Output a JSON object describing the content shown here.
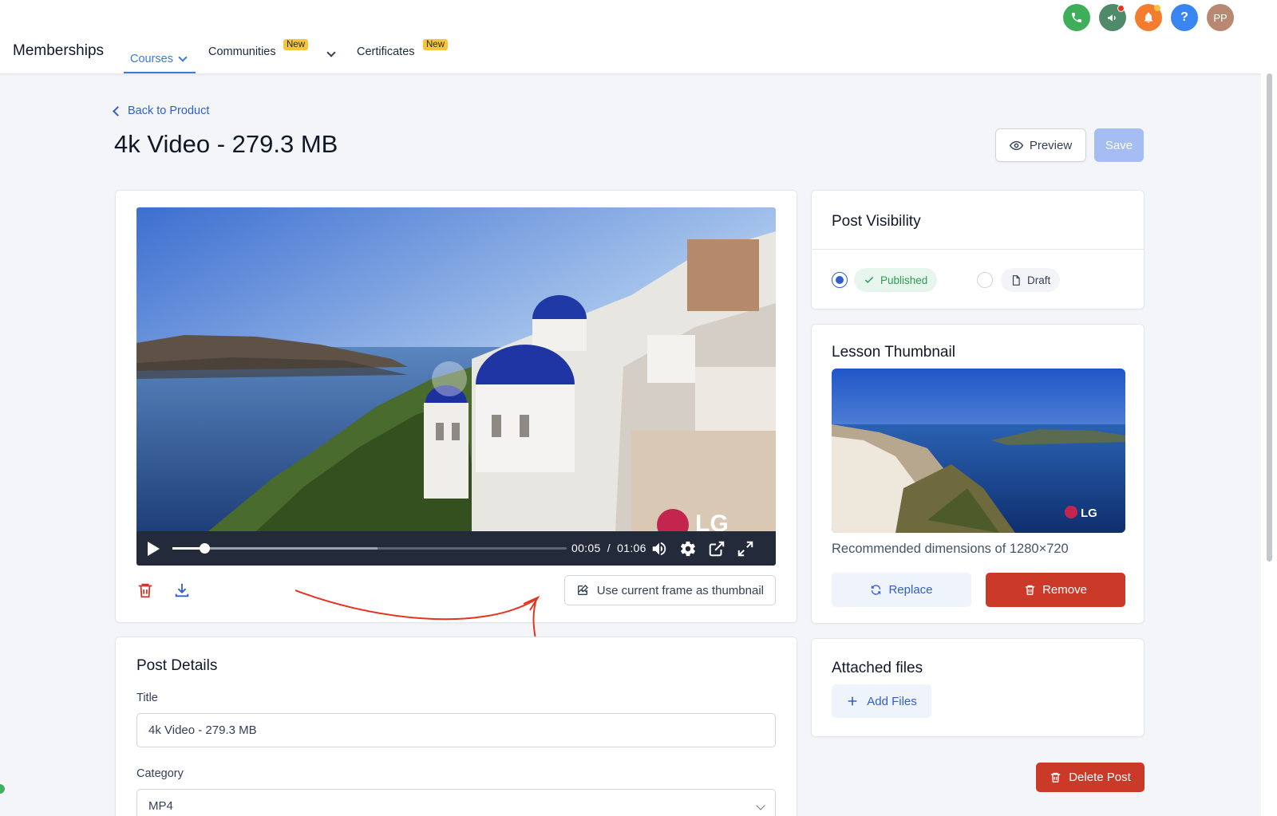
{
  "nav": {
    "brand": "Memberships",
    "courses": "Courses",
    "communities": "Communities",
    "certificates": "Certificates",
    "new_badge": "New"
  },
  "top_icons": {
    "avatar": "PP",
    "help": "?"
  },
  "header": {
    "back": "Back to Product",
    "title": "4k Video - 279.3 MB",
    "preview": "Preview",
    "save": "Save"
  },
  "video": {
    "current_time": "00:05",
    "separator": "/",
    "duration": "01:06",
    "progress_fraction": 0.08,
    "buffered_fraction": 0.52,
    "use_frame": "Use current frame as thumbnail"
  },
  "details": {
    "heading": "Post Details",
    "title_label": "Title",
    "title_value": "4k Video - 279.3 MB",
    "category_label": "Category",
    "category_value": "MP4"
  },
  "visibility": {
    "heading": "Post Visibility",
    "published": "Published",
    "draft": "Draft",
    "selected": "Published"
  },
  "thumbnail": {
    "heading": "Lesson Thumbnail",
    "recommended": "Recommended dimensions of 1280×720",
    "replace": "Replace",
    "remove": "Remove",
    "logo": "LG"
  },
  "files": {
    "heading": "Attached files",
    "add": "Add Files"
  },
  "delete_post": "Delete Post",
  "colors": {
    "primary": "#2f5fcf",
    "danger": "#cb3a28",
    "success": "#2e9a54",
    "badge": "#f6c53b"
  }
}
